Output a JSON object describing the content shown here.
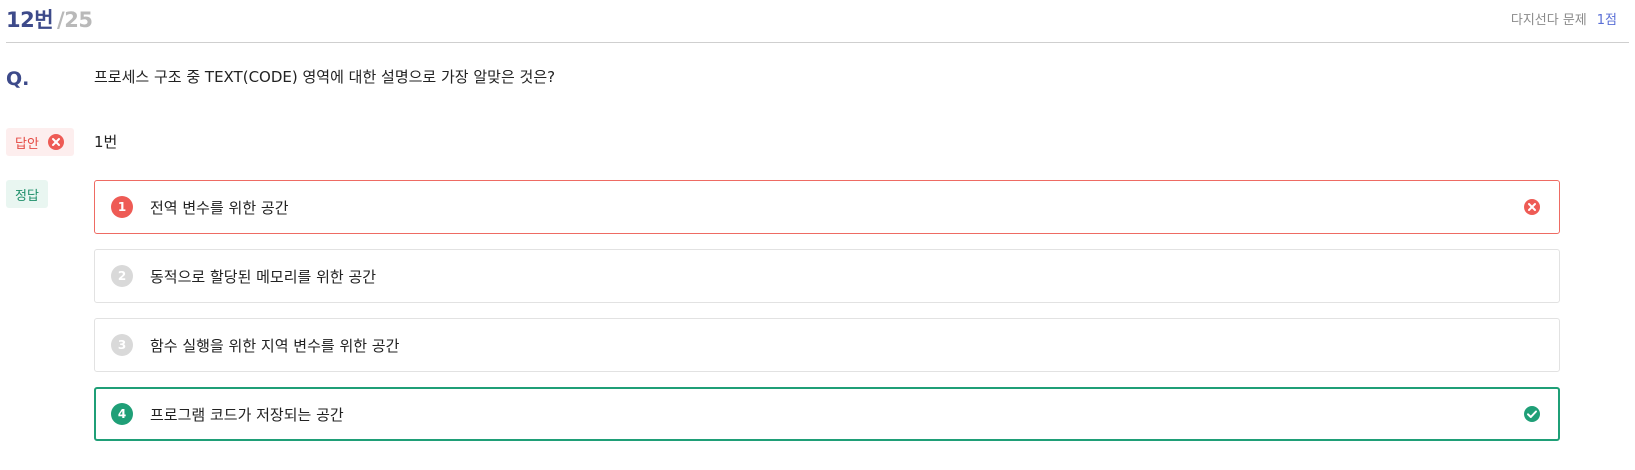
{
  "header": {
    "question_number": "12번",
    "question_total": "/25",
    "question_type": "다지선다 문제",
    "points": "1점"
  },
  "question": {
    "label": "Q.",
    "text": "프로세스 구조 중 TEXT(CODE) 영역에 대한 설명으로 가장 알맞은 것은?"
  },
  "answer": {
    "label": "답안",
    "value": "1번",
    "status_icon": "x-circle-icon"
  },
  "correct": {
    "label": "정답"
  },
  "options": [
    {
      "num": "1",
      "text": "전역 변수를 위한 공간",
      "state": "wrong",
      "status_icon": "x-circle-icon"
    },
    {
      "num": "2",
      "text": "동적으로 할당된 메모리를 위한 공간",
      "state": "neutral"
    },
    {
      "num": "3",
      "text": "함수 실행을 위한 지역 변수를 위한 공간",
      "state": "neutral"
    },
    {
      "num": "4",
      "text": "프로그램 코드가 저장되는 공간",
      "state": "correct",
      "status_icon": "check-circle-icon"
    }
  ],
  "colors": {
    "accent": "#3d4a8a",
    "wrong": "#ee5b55",
    "correct": "#1f9f77",
    "neutral_number": "#d9d9d9"
  }
}
